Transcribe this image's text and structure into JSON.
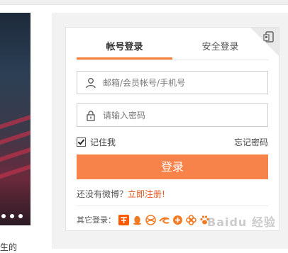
{
  "login": {
    "tabs": [
      {
        "label": "帐号登录",
        "active": true
      },
      {
        "label": "安全登录",
        "active": false
      }
    ],
    "username_placeholder": "邮箱/会员帐号/手机号",
    "password_placeholder": "请输入密码",
    "remember_label": "记住我",
    "remember_checked": true,
    "forgot_label": "忘记密码",
    "submit_label": "登录",
    "register_prompt": "还没有微博？",
    "register_link": "立即注册!",
    "other_login_label": "其它登录：",
    "other_login_icons": [
      "taobao-icon",
      "qq-icon",
      "china-mobile-icon",
      "tianyi-icon",
      "ctrip-icon",
      "unicom-icon",
      "baidu-paw-icon"
    ]
  },
  "background": {
    "caption": "生的"
  },
  "watermark": "Baidu 经验",
  "colors": {
    "accent": "#f7834a",
    "tab_underline": "#f77f37",
    "link": "#e8541e"
  }
}
